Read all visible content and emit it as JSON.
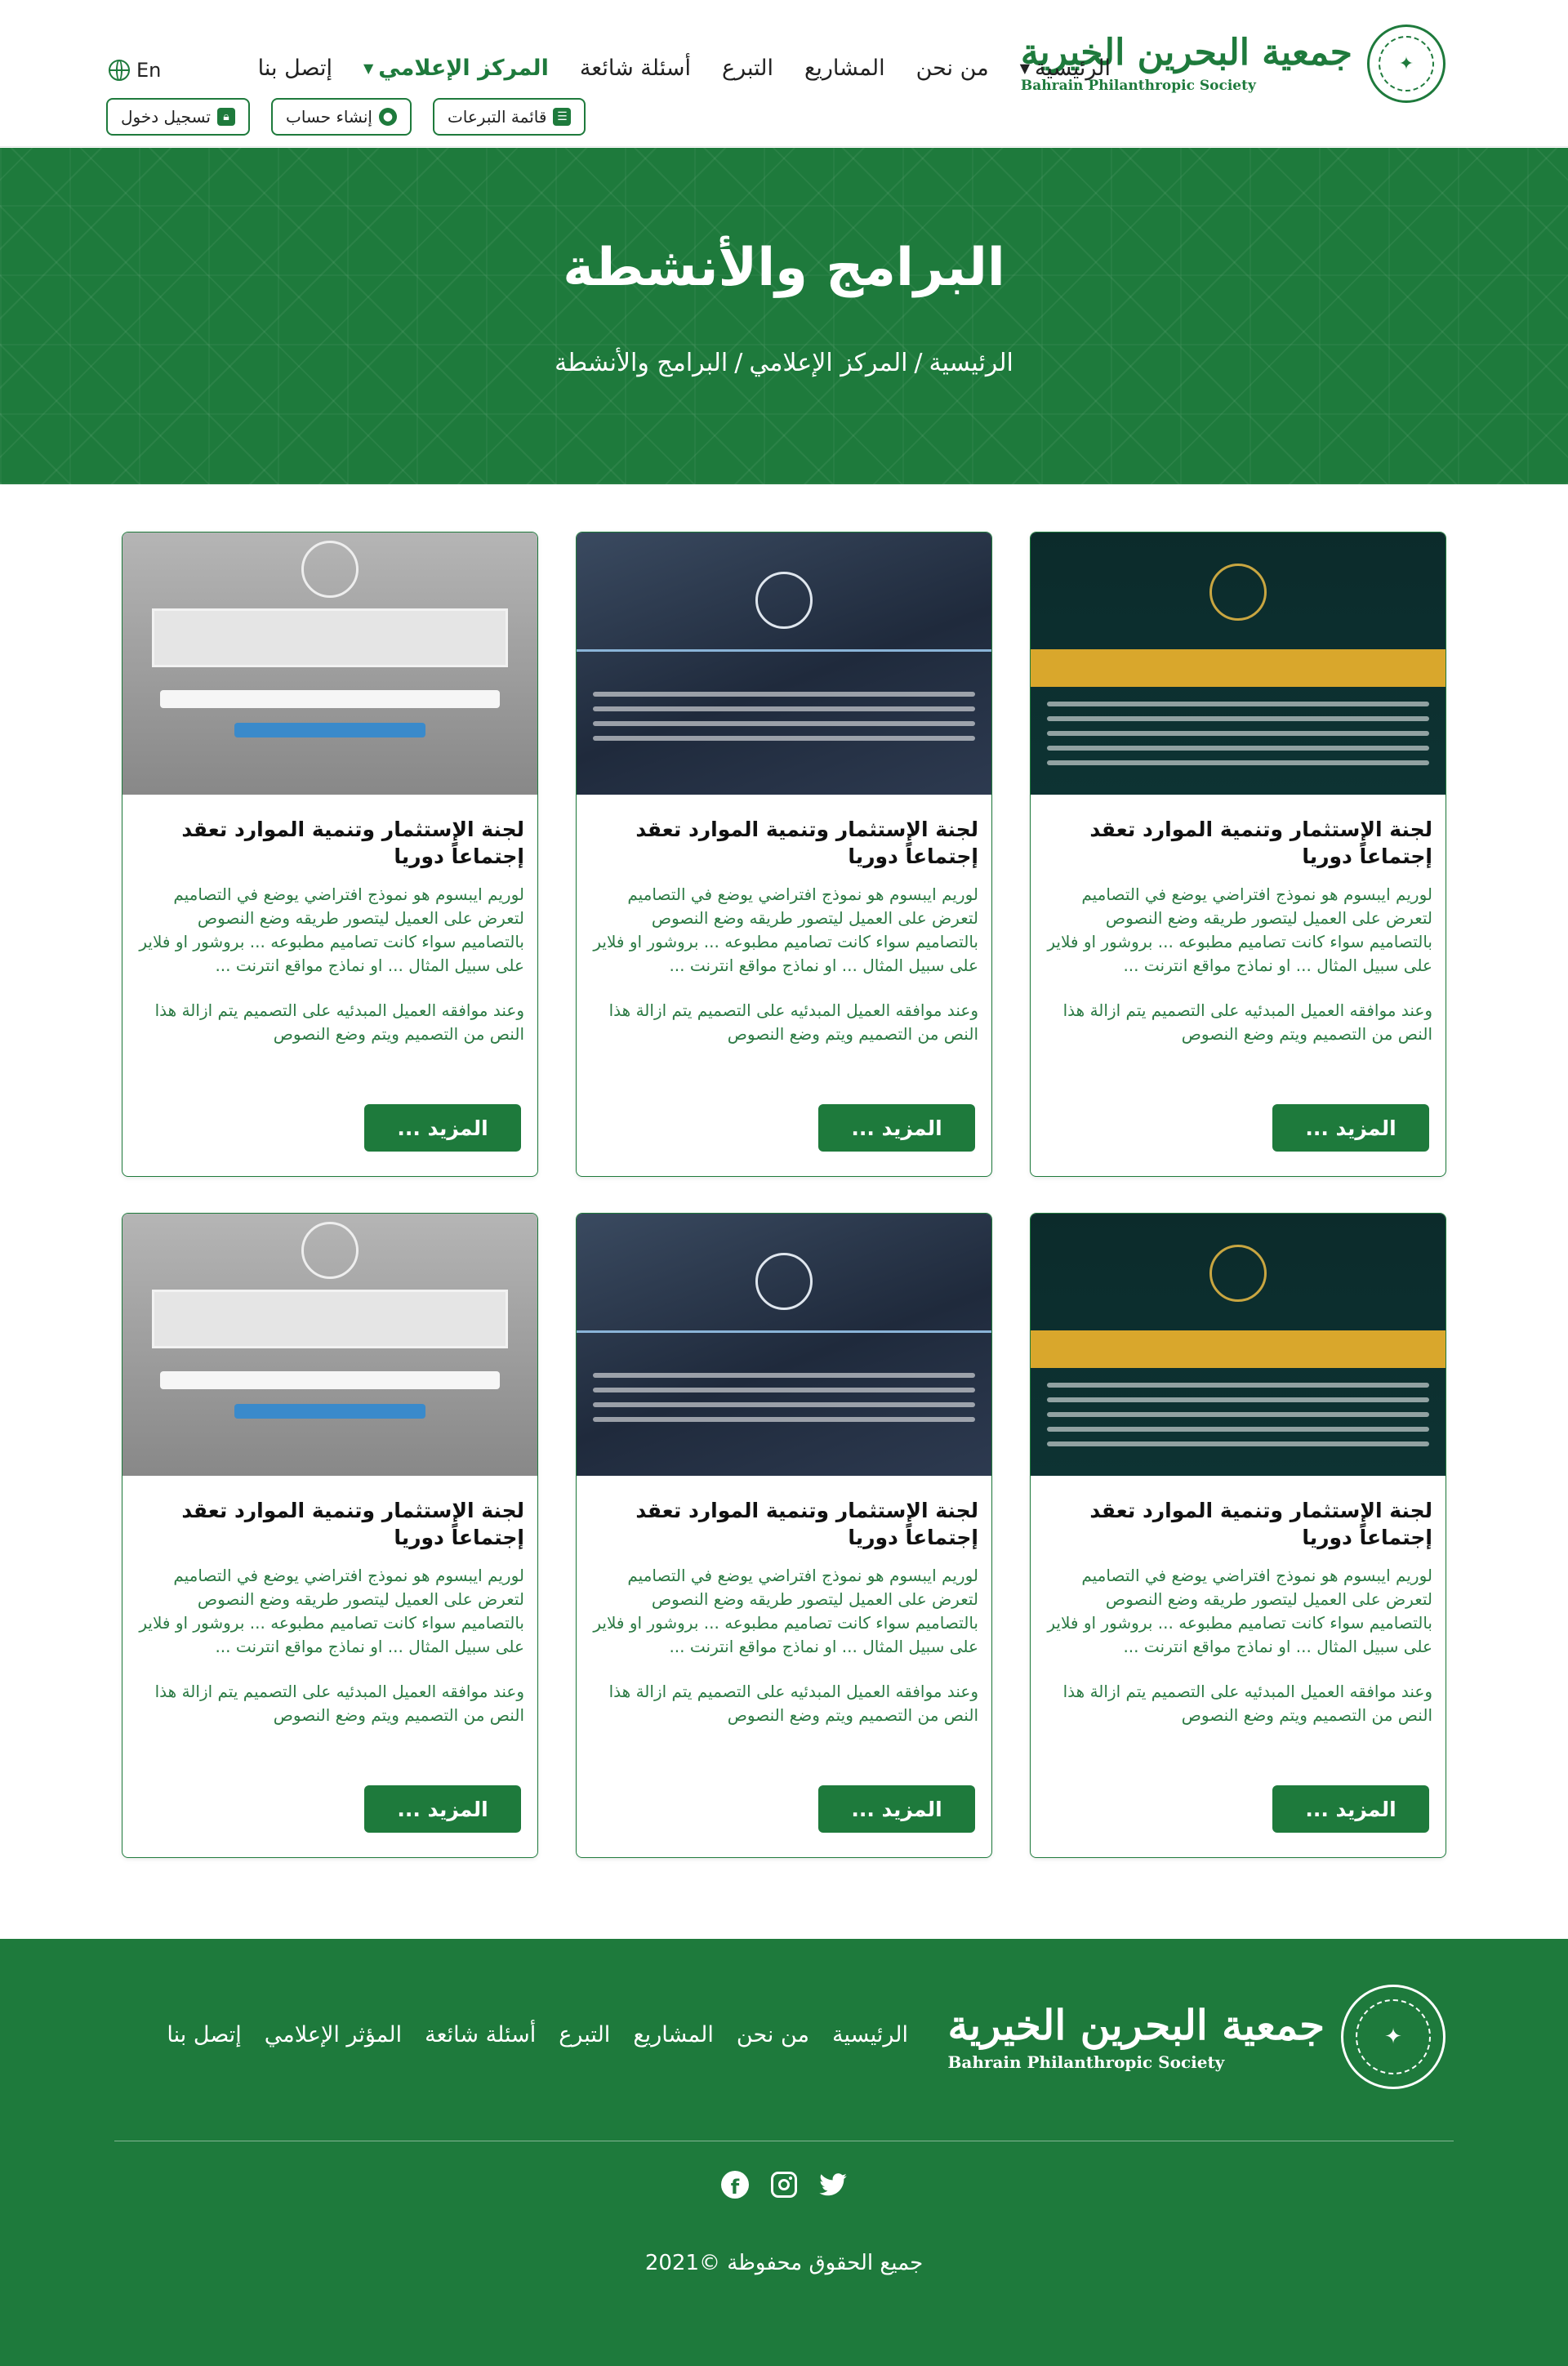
{
  "header": {
    "logo": {
      "arabic": "جمعية البحرين الخيرية",
      "english": "Bahrain Philanthropic Society"
    },
    "nav": [
      {
        "label": "الرئيسية",
        "has_dropdown": true,
        "active": false
      },
      {
        "label": "من نحن",
        "has_dropdown": false,
        "active": false
      },
      {
        "label": "المشاريع",
        "has_dropdown": false,
        "active": false
      },
      {
        "label": "التبرع",
        "has_dropdown": false,
        "active": false
      },
      {
        "label": "أسئلة شائعة",
        "has_dropdown": false,
        "active": false
      },
      {
        "label": "المركز الإعلامي",
        "has_dropdown": true,
        "active": true
      },
      {
        "label": "إتصل بنا",
        "has_dropdown": false,
        "active": false
      }
    ],
    "lang_label": "En",
    "buttons": {
      "donations_list": "قائمة التبرعات",
      "create_account": "إنشاء حساب",
      "login": "تسجيل دخول"
    }
  },
  "hero": {
    "title": "البرامج والأنشطة",
    "breadcrumb": [
      "الرئيسية",
      "المركز الإعلامي",
      "البرامج والأنشطة"
    ]
  },
  "cards": [
    {
      "image": "dark",
      "title": "لجنة الإستثمار وتنمية الموارد تعقد إجتماعاً دوريا",
      "text": "لوريم ايبسوم هو نموذج افتراضي يوضع في التصاميم لتعرض على العميل ليتصور طريقه وضع النصوص بالتصاميم سواء كانت تصاميم مطبوعه ... بروشور او فلاير على سبيل المثال ... او نماذج مواقع انترنت ...",
      "text2": "وعند موافقه العميل المبدئيه على التصميم يتم ازالة هذا النص من التصميم ويتم وضع النصوص",
      "more": "المزيد ..."
    },
    {
      "image": "navy",
      "title": "لجنة الإستثمار وتنمية الموارد تعقد إجتماعاً دوريا",
      "text": "لوريم ايبسوم هو نموذج افتراضي يوضع في التصاميم لتعرض على العميل ليتصور طريقه وضع النصوص بالتصاميم سواء كانت تصاميم مطبوعه ... بروشور او فلاير على سبيل المثال ... او نماذج مواقع انترنت ...",
      "text2": "وعند موافقه العميل المبدئيه على التصميم يتم ازالة هذا النص من التصميم ويتم وضع النصوص",
      "more": "المزيد ..."
    },
    {
      "image": "grey",
      "title": "لجنة الإستثمار وتنمية الموارد تعقد إجتماعاً دوريا",
      "text": "لوريم ايبسوم هو نموذج افتراضي يوضع في التصاميم لتعرض على العميل ليتصور طريقه وضع النصوص بالتصاميم سواء كانت تصاميم مطبوعه ... بروشور او فلاير على سبيل المثال ... او نماذج مواقع انترنت ...",
      "text2": "وعند موافقه العميل المبدئيه على التصميم يتم ازالة هذا النص من التصميم ويتم وضع النصوص",
      "more": "المزيد ..."
    },
    {
      "image": "dark",
      "title": "لجنة الإستثمار وتنمية الموارد تعقد إجتماعاً دوريا",
      "text": "لوريم ايبسوم هو نموذج افتراضي يوضع في التصاميم لتعرض على العميل ليتصور طريقه وضع النصوص بالتصاميم سواء كانت تصاميم مطبوعه ... بروشور او فلاير على سبيل المثال ... او نماذج مواقع انترنت ...",
      "text2": "وعند موافقه العميل المبدئيه على التصميم يتم ازالة هذا النص من التصميم ويتم وضع النصوص",
      "more": "المزيد ..."
    },
    {
      "image": "navy",
      "title": "لجنة الإستثمار وتنمية الموارد تعقد إجتماعاً دوريا",
      "text": "لوريم ايبسوم هو نموذج افتراضي يوضع في التصاميم لتعرض على العميل ليتصور طريقه وضع النصوص بالتصاميم سواء كانت تصاميم مطبوعه ... بروشور او فلاير على سبيل المثال ... او نماذج مواقع انترنت ...",
      "text2": "وعند موافقه العميل المبدئيه على التصميم يتم ازالة هذا النص من التصميم ويتم وضع النصوص",
      "more": "المزيد ..."
    },
    {
      "image": "grey",
      "title": "لجنة الإستثمار وتنمية الموارد تعقد إجتماعاً دوريا",
      "text": "لوريم ايبسوم هو نموذج افتراضي يوضع في التصاميم لتعرض على العميل ليتصور طريقه وضع النصوص بالتصاميم سواء كانت تصاميم مطبوعه ... بروشور او فلاير على سبيل المثال ... او نماذج مواقع انترنت ...",
      "text2": "وعند موافقه العميل المبدئيه على التصميم يتم ازالة هذا النص من التصميم ويتم وضع النصوص",
      "more": "المزيد ..."
    }
  ],
  "footer": {
    "logo": {
      "arabic": "جمعية البحرين الخيرية",
      "english": "Bahrain Philanthropic Society"
    },
    "nav": [
      "الرئيسية",
      "من نحن",
      "المشاريع",
      "التبرع",
      "أسئلة شائعة",
      "المؤثر الإعلامي",
      "إتصل بنا"
    ],
    "socials": [
      "facebook-icon",
      "instagram-icon",
      "twitter-icon"
    ],
    "copyright": "جميع الحقوق محفوظة ©2021"
  },
  "colors": {
    "brand_green": "#1e7a3c",
    "white": "#ffffff"
  }
}
